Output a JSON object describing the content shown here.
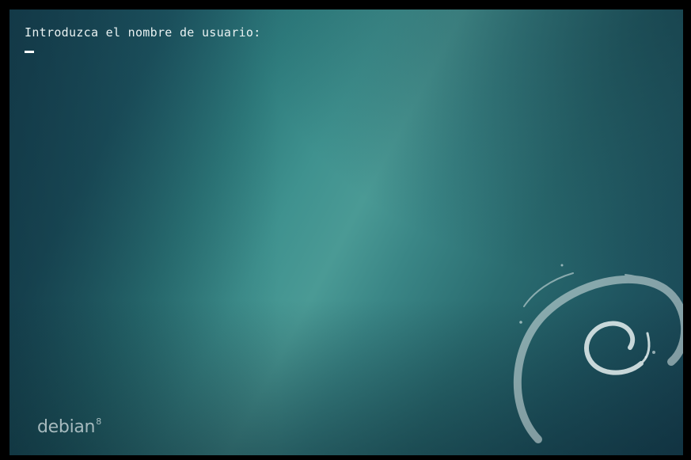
{
  "console": {
    "prompt": "Introduzca el nombre de usuario:",
    "input_value": ""
  },
  "branding": {
    "name": "debian",
    "version": "8",
    "swirl_icon": "debian-swirl-icon"
  },
  "colors": {
    "background_dark": "#173f4f",
    "background_light": "#4a9a95",
    "text": "#e8f1f1",
    "frame": "#000000"
  }
}
